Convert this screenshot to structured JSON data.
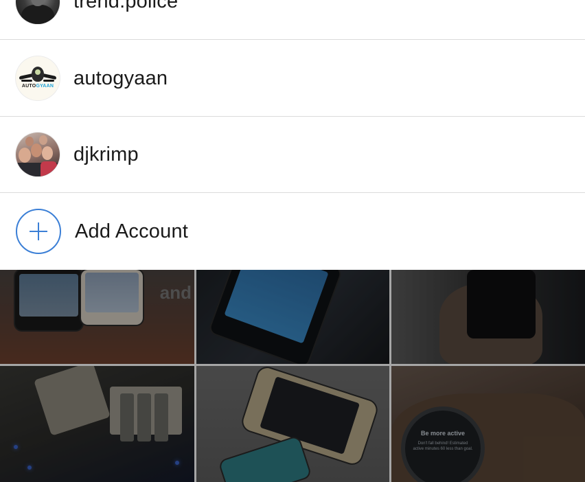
{
  "accounts": [
    {
      "username": "trend.police",
      "avatar_icon": "trend-police-avatar"
    },
    {
      "username": "autogyaan",
      "avatar_icon": "autogyaan-logo-avatar",
      "logo_text": "AUTOGYAAN"
    },
    {
      "username": "djkrimp",
      "avatar_icon": "djkrimp-group-avatar"
    }
  ],
  "add_account": {
    "label": "Add Account",
    "icon": "plus-circle-icon",
    "accent": "#3b7fd6"
  },
  "background_grid": {
    "tiles": [
      {
        "caption": "and"
      },
      {
        "caption": ""
      },
      {
        "caption": ""
      },
      {
        "caption": ""
      },
      {
        "caption": ""
      },
      {
        "caption": "Be more active"
      }
    ],
    "watch_subtext": "Don't fall behind! Estimated active minutes 60 less than goal."
  },
  "colors": {
    "divider": "#dbdbdb",
    "text": "#1a1a1a",
    "accent": "#3b7fd6"
  }
}
